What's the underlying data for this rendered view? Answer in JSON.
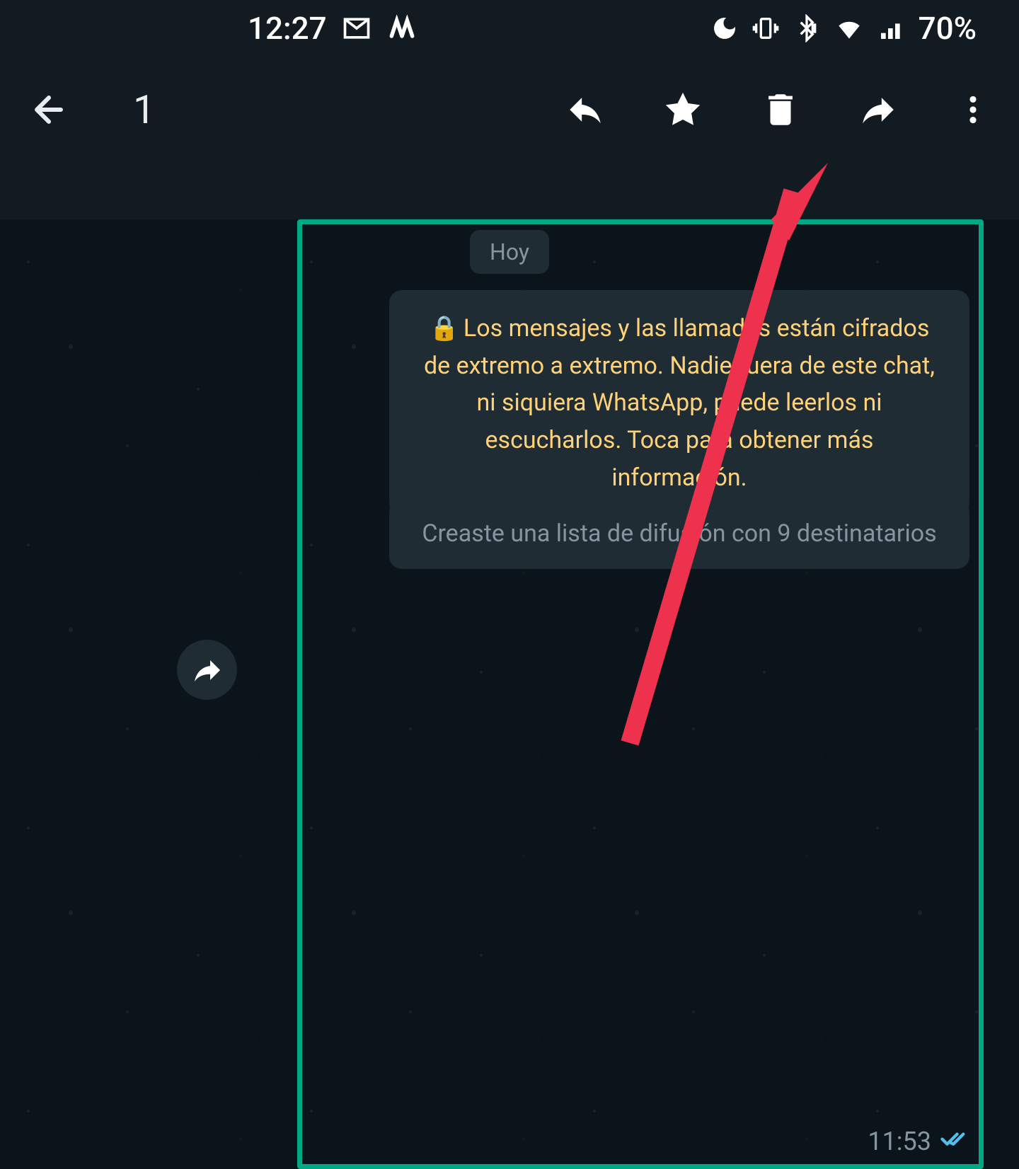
{
  "status_bar": {
    "time": "12:27",
    "battery": "70%"
  },
  "toolbar": {
    "selected_count": "1"
  },
  "chat": {
    "date_label": "Hoy",
    "encryption_text": "Los mensajes y las llamadas están cifrados de extremo a extremo. Nadie fuera de este chat, ni siquiera WhatsApp, puede leerlos ni escucharlos. Toca para obtener más información.",
    "broadcast_text": "Creaste una lista de difusión con 9 destinatarios",
    "message_time": "11:53"
  }
}
